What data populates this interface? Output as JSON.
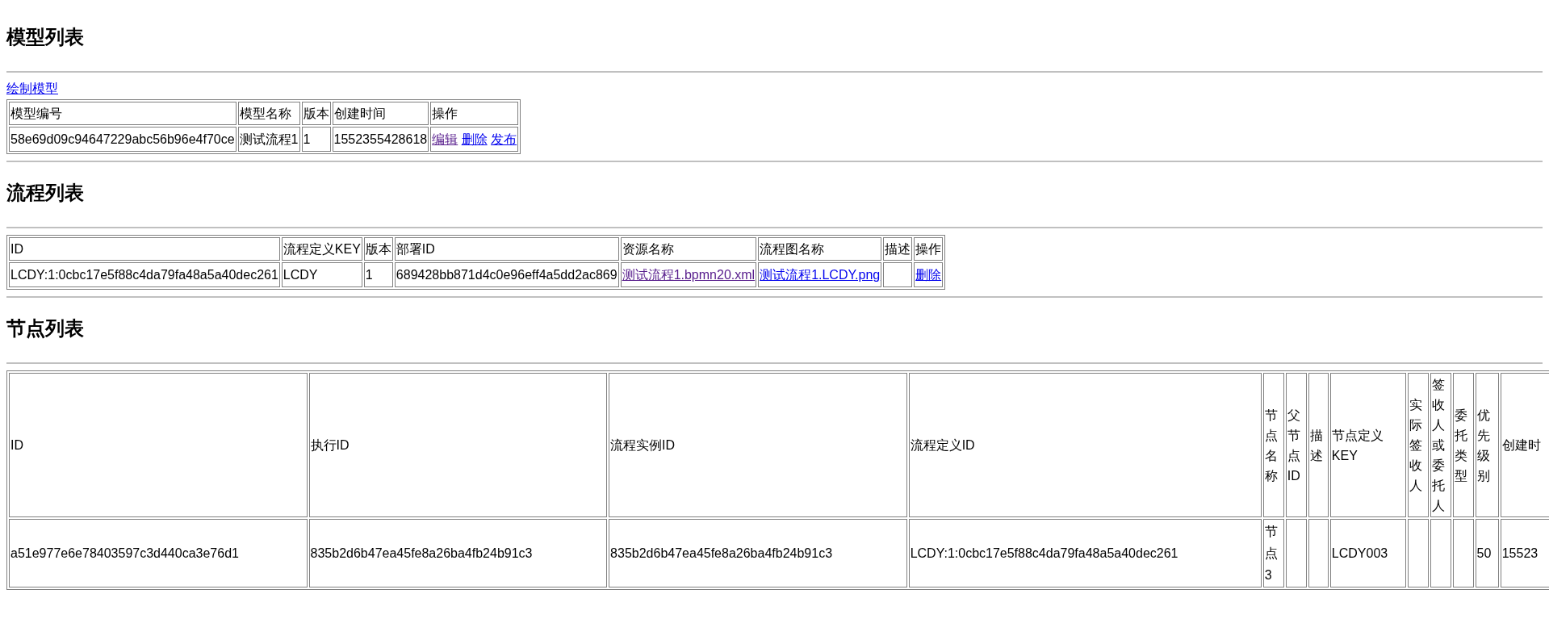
{
  "sections": [
    {
      "title": "模型列表",
      "actions": [
        {
          "label": "绘制模型",
          "visited": false
        }
      ],
      "table": {
        "kind": "compact",
        "columns": [
          "模型编号",
          "模型名称",
          "版本",
          "创建时间",
          "操作"
        ],
        "rows": [
          {
            "cells": [
              {
                "kind": "text",
                "text": "58e69d09c94647229abc56b96e4f70ce"
              },
              {
                "kind": "text",
                "text": "测试流程1"
              },
              {
                "kind": "text",
                "text": "1"
              },
              {
                "kind": "text",
                "text": "1552355428618"
              },
              {
                "kind": "links",
                "links": [
                  {
                    "label": "编辑",
                    "visited": true
                  },
                  {
                    "label": "删除",
                    "visited": false
                  },
                  {
                    "label": "发布",
                    "visited": false
                  }
                ]
              }
            ]
          }
        ]
      }
    },
    {
      "title": "流程列表",
      "table": {
        "kind": "compact",
        "columns": [
          "ID",
          "流程定义KEY",
          "版本",
          "部署ID",
          "资源名称",
          "流程图名称",
          "描述",
          "操作"
        ],
        "rows": [
          {
            "cells": [
              {
                "kind": "text",
                "text": "LCDY:1:0cbc17e5f88c4da79fa48a5a40dec261"
              },
              {
                "kind": "text",
                "text": "LCDY"
              },
              {
                "kind": "text",
                "text": "1"
              },
              {
                "kind": "text",
                "text": "689428bb871d4c0e96eff4a5dd2ac869"
              },
              {
                "kind": "links",
                "links": [
                  {
                    "label": "测试流程1.bpmn20.xml",
                    "visited": true
                  }
                ]
              },
              {
                "kind": "links",
                "links": [
                  {
                    "label": "测试流程1.LCDY.png",
                    "visited": false
                  }
                ]
              },
              {
                "kind": "empty"
              },
              {
                "kind": "links",
                "links": [
                  {
                    "label": "删除",
                    "visited": false
                  }
                ]
              }
            ]
          }
        ]
      }
    },
    {
      "title": "节点列表",
      "table": {
        "kind": "wide",
        "columns": [
          "ID",
          "执行ID",
          "流程实例ID",
          "流程定义ID",
          "节点名称",
          "父节点ID",
          "描述",
          "节点定义KEY",
          "实际签收人",
          "签收人或委托人",
          "委托类型",
          "优先级别",
          "创建时"
        ],
        "rows": [
          {
            "cells": [
              {
                "kind": "text",
                "text": "a51e977e6e78403597c3d440ca3e76d1"
              },
              {
                "kind": "text",
                "text": "835b2d6b47ea45fe8a26ba4fb24b91c3"
              },
              {
                "kind": "text",
                "text": "835b2d6b47ea45fe8a26ba4fb24b91c3"
              },
              {
                "kind": "text",
                "text": "LCDY:1:0cbc17e5f88c4da79fa48a5a40dec261"
              },
              {
                "kind": "text",
                "text": "节点3"
              },
              {
                "kind": "empty"
              },
              {
                "kind": "empty"
              },
              {
                "kind": "text",
                "text": "LCDY003"
              },
              {
                "kind": "empty"
              },
              {
                "kind": "empty"
              },
              {
                "kind": "empty"
              },
              {
                "kind": "text",
                "text": "50"
              },
              {
                "kind": "text",
                "text": "15523"
              }
            ]
          }
        ]
      }
    }
  ]
}
